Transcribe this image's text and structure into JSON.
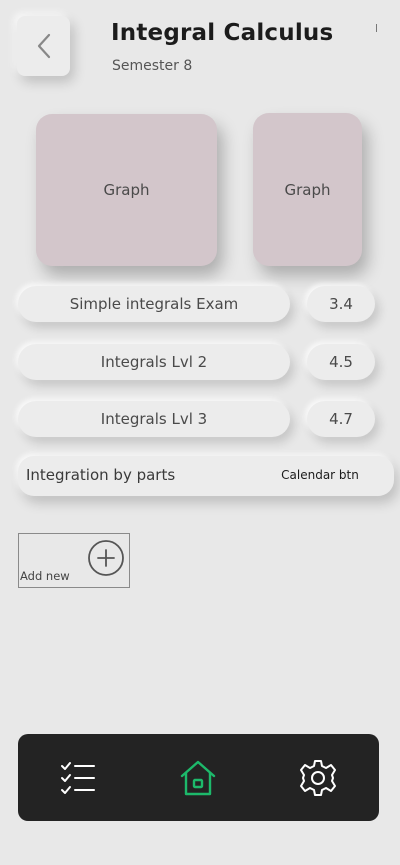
{
  "header": {
    "title": "Integral Calculus",
    "subtitle": "Semester 8"
  },
  "graphs": [
    {
      "label": "Graph"
    },
    {
      "label": "Graph"
    }
  ],
  "exams": [
    {
      "name": "Simple integrals Exam",
      "score": "3.4"
    },
    {
      "name": "Integrals Lvl 2",
      "score": "4.5"
    },
    {
      "name": "Integrals Lvl 3",
      "score": "4.7"
    }
  ],
  "calendar_item": {
    "label": "Integration by parts",
    "button_label": "Calendar btn"
  },
  "add_new": {
    "label": "Add new"
  },
  "nav": {
    "active": "home",
    "active_color": "#1db96b",
    "icons": [
      "checklist-icon",
      "home-icon",
      "gear-icon"
    ]
  }
}
